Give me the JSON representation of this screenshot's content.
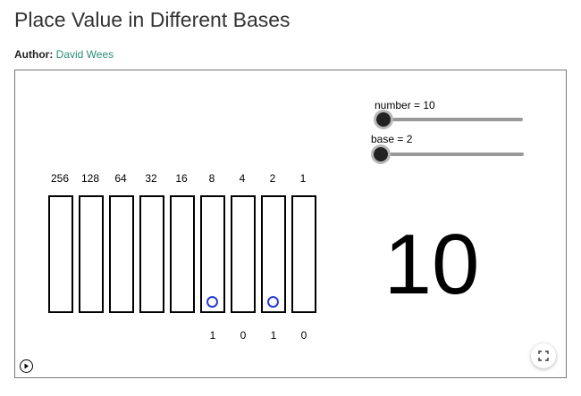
{
  "page": {
    "title": "Place Value in Different Bases",
    "author_label": "Author:",
    "author_name": "David Wees"
  },
  "applet": {
    "place_values": [
      "256",
      "128",
      "64",
      "32",
      "16",
      "8",
      "4",
      "2",
      "1"
    ],
    "digits": [
      "1",
      "0",
      "1",
      "0"
    ],
    "circle_columns": [
      5,
      7
    ],
    "sliders": {
      "number_label": "number = 10",
      "number_value": 10,
      "base_label": "base = 2",
      "base_value": 2
    },
    "display_number": "10"
  },
  "icons": {
    "play": "play-icon",
    "fullscreen": "fullscreen-icon"
  },
  "colors": {
    "link": "#2e8b7a",
    "circle": "#2a3fd6"
  }
}
